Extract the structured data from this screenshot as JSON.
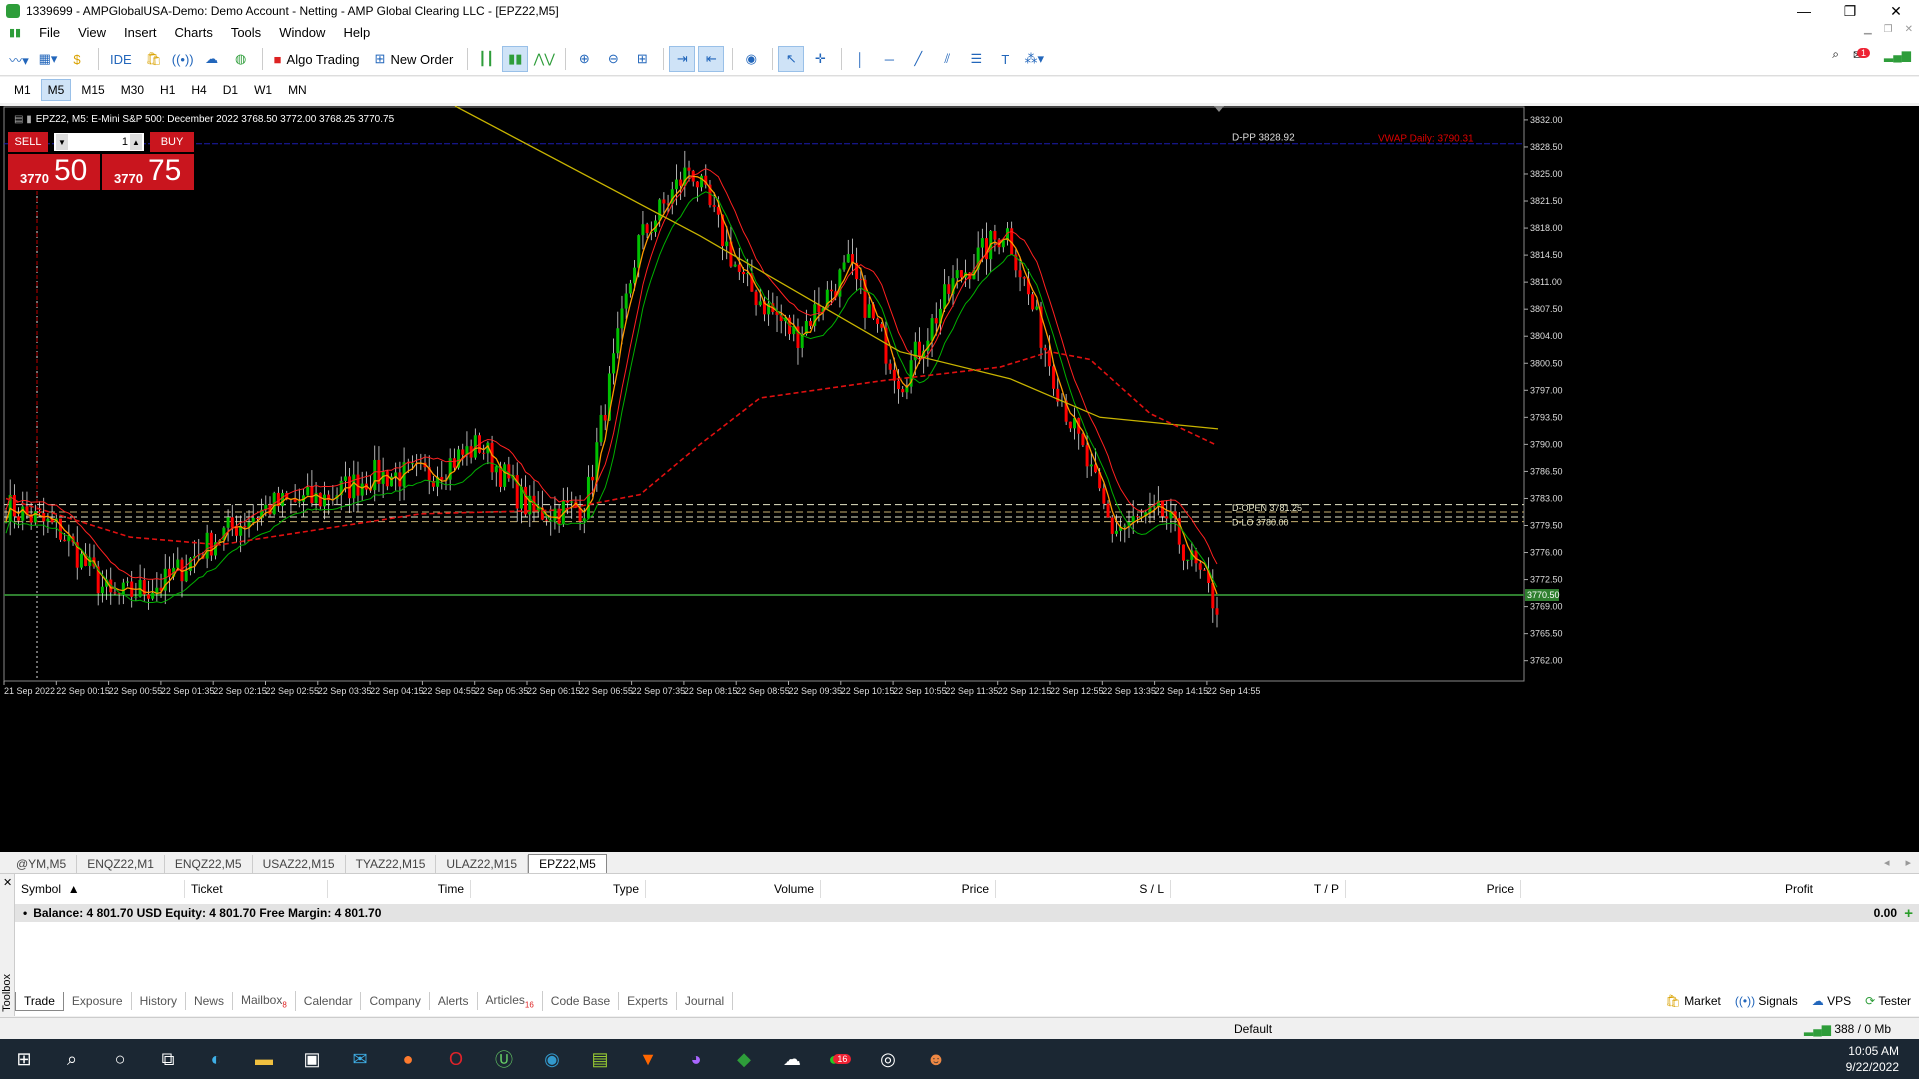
{
  "window": {
    "title": "1339699 - AMPGlobalUSA-Demo: Demo Account - Netting - AMP Global Clearing LLC - [EPZ22,M5]",
    "minimize": "—",
    "maximize": "❐",
    "close": "✕"
  },
  "menu": [
    "File",
    "View",
    "Insert",
    "Charts",
    "Tools",
    "Window",
    "Help"
  ],
  "toolbar": {
    "ide_label": "IDE",
    "algo_trading_label": "Algo Trading",
    "new_order_label": "New Order",
    "notifications_count": "1"
  },
  "timeframes": {
    "items": [
      "M1",
      "M5",
      "M15",
      "M30",
      "H1",
      "H4",
      "D1",
      "W1",
      "MN"
    ],
    "active": "M5"
  },
  "chart": {
    "header": "EPZ22, M5:  E-Mini S&P 500: December 2022  3768.50 3772.00 3768.25 3770.75",
    "trade_panel": {
      "sell_label": "SELL",
      "buy_label": "BUY",
      "lot": "1",
      "sell_small": "3770",
      "sell_big": "50",
      "buy_small": "3770",
      "buy_big": "75"
    },
    "level_labels": {
      "dpp": "D-PP 3828.92",
      "vwap": "VWAP Daily: 3790.31",
      "dopen": "D-OPEN 3781.25",
      "dlo": "D-LO 3780.00",
      "current_price": "3770.50"
    },
    "price_ticks": [
      "3832.00",
      "3828.50",
      "3825.00",
      "3821.50",
      "3818.00",
      "3814.50",
      "3811.00",
      "3807.50",
      "3804.00",
      "3800.50",
      "3797.00",
      "3793.50",
      "3790.00",
      "3786.50",
      "3783.00",
      "3779.50",
      "3776.00",
      "3772.50",
      "3769.00",
      "3765.50",
      "3762.00"
    ],
    "time_ticks": [
      "21 Sep 2022",
      "22 Sep 00:15",
      "22 Sep 00:55",
      "22 Sep 01:35",
      "22 Sep 02:15",
      "22 Sep 02:55",
      "22 Sep 03:35",
      "22 Sep 04:15",
      "22 Sep 04:55",
      "22 Sep 05:35",
      "22 Sep 06:15",
      "22 Sep 06:55",
      "22 Sep 07:35",
      "22 Sep 08:15",
      "22 Sep 08:55",
      "22 Sep 09:35",
      "22 Sep 10:15",
      "22 Sep 10:55",
      "22 Sep 11:35",
      "22 Sep 12:15",
      "22 Sep 12:55",
      "22 Sep 13:35",
      "22 Sep 14:15",
      "22 Sep 14:55"
    ],
    "colors": {
      "bull": "#00c000",
      "bear": "#ff0000",
      "ma_orange": "#ff9900",
      "ma_red": "#ff2020",
      "ma_green": "#00b000",
      "ma_yellow": "#c8b400",
      "ma_dash": "#e01010",
      "dpp_line": "#1c1cb0",
      "price_line": "#2f7f2f"
    }
  },
  "chart_data": {
    "type": "candlestick",
    "y_unit": "price",
    "ylim": [
      3759.5,
      3833.8
    ],
    "close_path_x_time": [
      "21 Sep 2022",
      "22 Sep 00:15",
      "22 Sep 00:55",
      "22 Sep 01:35",
      "22 Sep 02:15",
      "22 Sep 02:55",
      "22 Sep 03:35",
      "22 Sep 04:15",
      "22 Sep 04:55",
      "22 Sep 05:35",
      "22 Sep 06:15",
      "22 Sep 06:55",
      "22 Sep 07:35",
      "22 Sep 08:15",
      "22 Sep 08:55",
      "22 Sep 09:35",
      "22 Sep 10:15",
      "22 Sep 10:55",
      "22 Sep 11:35",
      "22 Sep 12:15",
      "22 Sep 12:55",
      "22 Sep 13:35",
      "22 Sep 14:15",
      "22 Sep 14:55"
    ],
    "close_path_approx": [
      3782,
      3779,
      3770,
      3772,
      3778,
      3782,
      3783,
      3786,
      3786,
      3790,
      3781,
      3782,
      3816,
      3826,
      3811,
      3804,
      3813,
      3798,
      3811,
      3818,
      3797,
      3779,
      3781,
      3769
    ]
  },
  "chart_tabs": {
    "items": [
      "@YM,M5",
      "ENQZ22,M1",
      "ENQZ22,M5",
      "USAZ22,M15",
      "TYAZ22,M15",
      "ULAZ22,M15",
      "EPZ22,M5"
    ],
    "active": "EPZ22,M5"
  },
  "toolbox": {
    "side_label": "Toolbox",
    "columns": [
      "Symbol",
      "Ticket",
      "Time",
      "Type",
      "Volume",
      "Price",
      "S / L",
      "T / P",
      "Price",
      "Profit"
    ],
    "balance_row": "Balance: 4 801.70 USD  Equity: 4 801.70  Free Margin: 4 801.70",
    "profit_value": "0.00",
    "tabs": [
      "Trade",
      "Exposure",
      "History",
      "News",
      "Mailbox",
      "Calendar",
      "Company",
      "Alerts",
      "Articles",
      "Code Base",
      "Experts",
      "Journal"
    ],
    "mailbox_count": "8",
    "articles_count": "16",
    "right_links": [
      "Market",
      "Signals",
      "VPS",
      "Tester"
    ]
  },
  "status": {
    "profile": "Default",
    "traffic": "388 / 0 Mb"
  },
  "taskbar": {
    "time": "10:05 AM",
    "date": "9/22/2022",
    "whatsapp_badge": "16"
  }
}
